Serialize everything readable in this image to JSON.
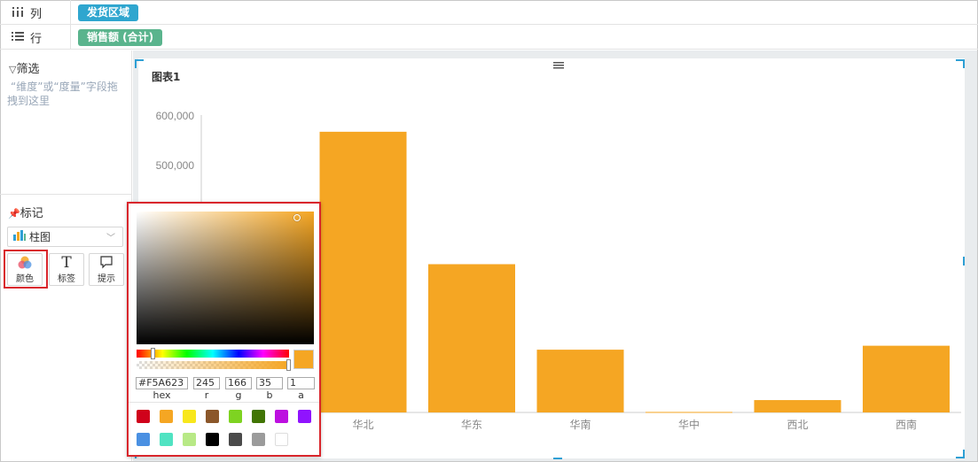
{
  "shelves": {
    "columns": {
      "icon": "columns-icon",
      "label": "列",
      "pill": "发货区域",
      "pill_color": "#2fa6cf"
    },
    "rows": {
      "icon": "rows-icon",
      "label": "行",
      "pill": "销售额 (合计)",
      "pill_color": "#5ab48d"
    }
  },
  "filter": {
    "title": "筛选",
    "hint": "“维度”或“度量”字段拖拽到这里"
  },
  "marks": {
    "title": "标记",
    "chart_type": "柱图",
    "buttons": [
      {
        "icon": "color-icon",
        "label": "颜色"
      },
      {
        "icon": "label-icon",
        "label": "标签"
      },
      {
        "icon": "tooltip-icon",
        "label": "提示"
      }
    ]
  },
  "chart": {
    "title": "图表1",
    "bar_color": "#F5A623"
  },
  "chart_data": {
    "type": "bar",
    "categories": [
      "",
      "华北",
      "华东",
      "华南",
      "华中",
      "西北",
      "西南"
    ],
    "values": [
      null,
      568000,
      300000,
      127000,
      1000,
      25000,
      135000
    ],
    "ylim": [
      0,
      660000
    ],
    "yticks": [
      500000,
      600000
    ],
    "ytick_labels": [
      "500,000",
      "600,000"
    ],
    "grid": false
  },
  "color_picker": {
    "hex": "#F5A623",
    "r": "245",
    "g": "166",
    "b": "35",
    "a": "1",
    "labels": {
      "hex": "hex",
      "r": "r",
      "g": "g",
      "b": "b",
      "a": "a"
    },
    "current_color": "#F5A623",
    "swatches": [
      "#D0021B",
      "#F5A623",
      "#F8E71C",
      "#8B572A",
      "#7ED321",
      "#417505",
      "#BD10E0",
      "#9013FE",
      "#4A90E2",
      "#50E3C2",
      "#B8E986",
      "#000000",
      "#4A4A4A",
      "#9B9B9B",
      "#FFFFFF"
    ]
  }
}
